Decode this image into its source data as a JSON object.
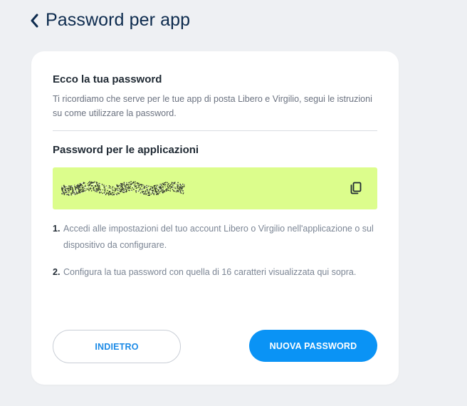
{
  "header": {
    "title": "Password per app",
    "back_icon": "chevron-left-icon"
  },
  "card": {
    "title": "Ecco la tua password",
    "description": "Ti ricordiamo che serve per le tue app di posta Libero e Virgilio, segui le istruzioni su come utilizzare la password.",
    "password_section_title": "Password per le applicazioni",
    "password_box_color": "#dcfd8c",
    "copy_icon": "copy-icon",
    "steps": [
      {
        "num": "1.",
        "text": "Accedi alle impostazioni del tuo account Libero o Virgilio nell'applicazione o sul dispositivo da configurare."
      },
      {
        "num": "2.",
        "text": "Configura la tua password con quella di 16 caratteri visualizzata qui sopra."
      }
    ]
  },
  "buttons": {
    "back_label": "INDIETRO",
    "new_password_label": "NUOVA PASSWORD"
  },
  "colors": {
    "accent": "#0a93f5",
    "title": "#0d2b4e"
  }
}
